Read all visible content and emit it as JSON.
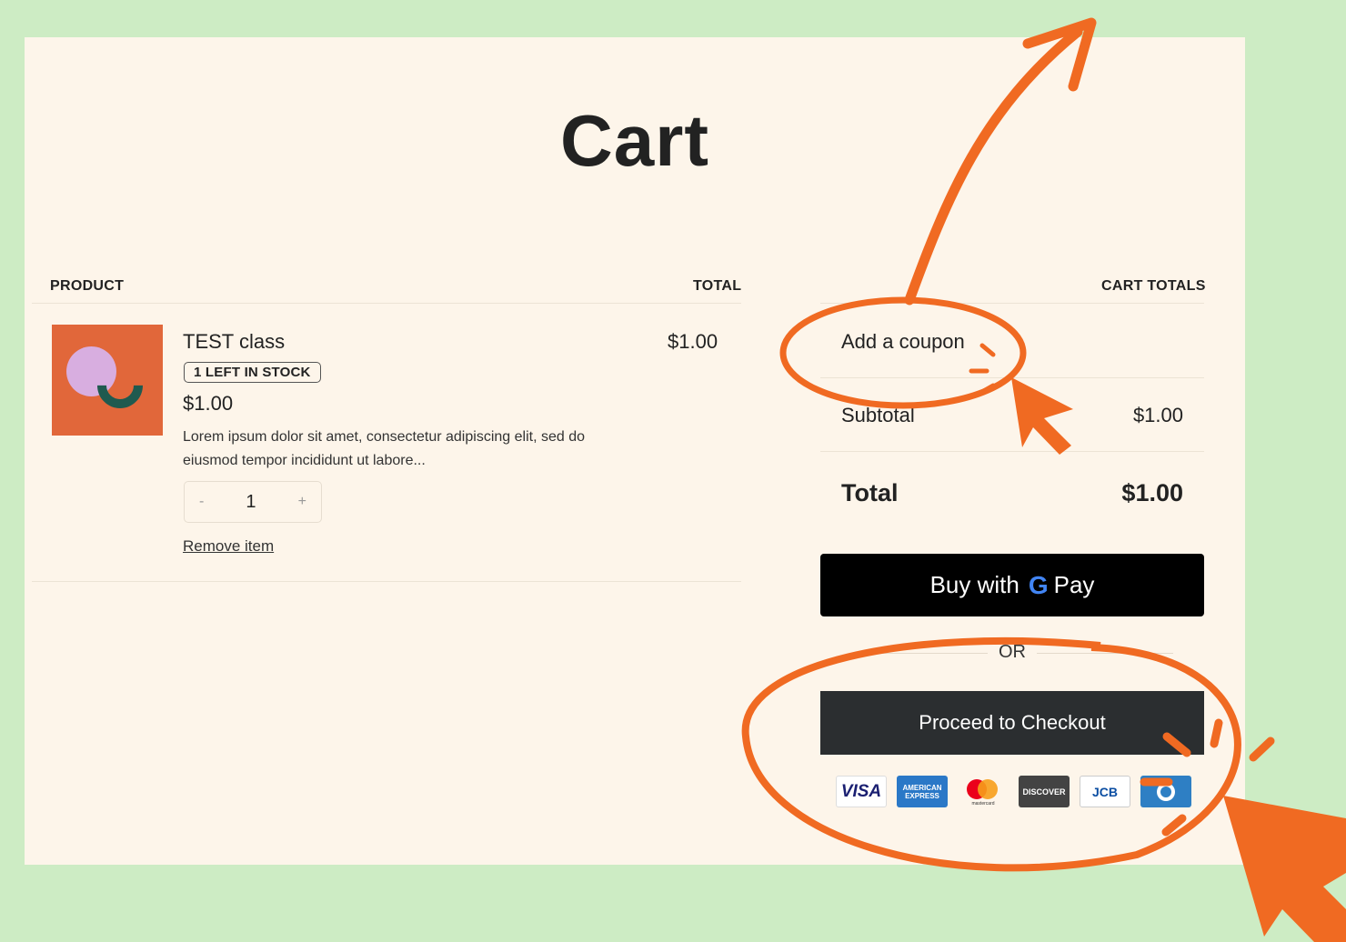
{
  "page": {
    "title": "Cart"
  },
  "table": {
    "product_header": "PRODUCT",
    "total_header": "TOTAL",
    "item": {
      "name": "TEST class",
      "stock_badge": "1 LEFT IN STOCK",
      "price": "$1.00",
      "description": "Lorem ipsum dolor sit amet, consectetur adipiscing elit, sed do eiusmod tempor incididunt ut labore...",
      "quantity": "1",
      "minus": "-",
      "plus": "+",
      "remove_label": "Remove item",
      "line_total": "$1.00"
    }
  },
  "totals": {
    "header": "CART TOTALS",
    "coupon_label": "Add a coupon",
    "subtotal_label": "Subtotal",
    "subtotal_value": "$1.00",
    "total_label": "Total",
    "total_value": "$1.00"
  },
  "checkout": {
    "gpay_prefix": "Buy with",
    "gpay_g": "G",
    "gpay_suffix": "Pay",
    "or_label": "OR",
    "proceed_label": "Proceed to Checkout",
    "cards": [
      "VISA",
      "AMERICAN EXPRESS",
      "mastercard",
      "DISCOVER",
      "JCB",
      "Diners Club"
    ]
  },
  "colors": {
    "background": "#cdecc4",
    "panel": "#fdf5ea",
    "annotation": "#f06a22",
    "checkout_button": "#2b2e30",
    "gpay_button": "#000000",
    "thumbnail": "#e1673a"
  }
}
